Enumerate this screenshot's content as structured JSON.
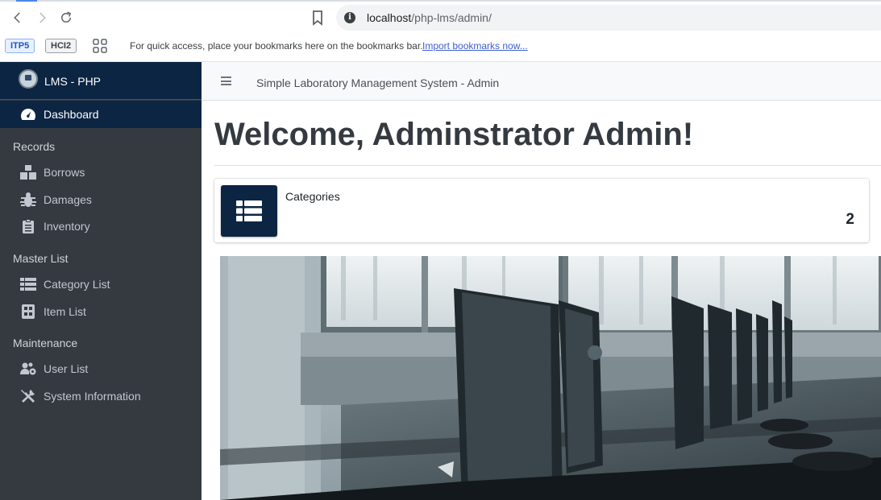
{
  "browser": {
    "url_host": "localhost",
    "url_path": "/php-lms/admin/",
    "bookmarks": [
      "ITP5",
      "HCI2"
    ],
    "bookmarks_message": "For quick access, place your bookmarks here on the bookmarks bar.",
    "import_link": "Import bookmarks now..."
  },
  "sidebar": {
    "brand": "LMS - PHP",
    "dashboard": "Dashboard",
    "sections": [
      {
        "header": "Records",
        "items": [
          "Borrows",
          "Damages",
          "Inventory"
        ]
      },
      {
        "header": "Master List",
        "items": [
          "Category List",
          "Item List"
        ]
      },
      {
        "header": "Maintenance",
        "items": [
          "User List",
          "System Information"
        ]
      }
    ]
  },
  "topbar": {
    "title": "Simple Laboratory Management System - Admin"
  },
  "main": {
    "welcome": "Welcome, Adminstrator Admin!",
    "info_box": {
      "label": "Categories",
      "number": "2"
    }
  },
  "colors": {
    "brand_navy": "#0c2543",
    "sidebar_bg": "#343a40",
    "sidebar_text": "#c2c7d0"
  }
}
